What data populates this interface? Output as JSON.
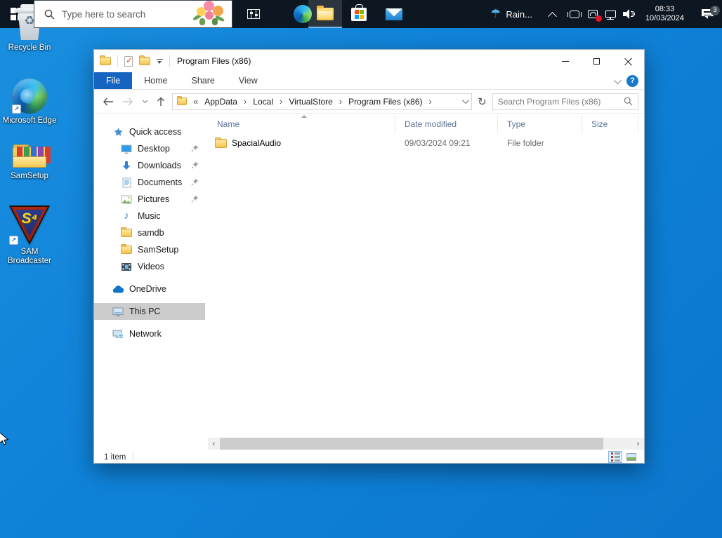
{
  "colors": {
    "accent_blue": "#0078d7",
    "file_tab_blue": "#1565c0",
    "desktop_blue": "#0f82d8",
    "taskbar_dark": "#0d1722",
    "selection_gray": "#cccccc",
    "folder_yellow": "#fbd968",
    "alert_red": "#e81224"
  },
  "glyphs": {
    "check": "✓",
    "refresh": "↻",
    "music_note": "♪",
    "recycle": "♻",
    "umbrella": "☂",
    "shortcut_arrow": "↗",
    "scroll_left": "‹",
    "scroll_right": "›",
    "help": "?"
  },
  "desktop": {
    "icons": [
      {
        "label": "Recycle Bin",
        "icon": "recycle-bin-icon"
      },
      {
        "label": "Microsoft Edge",
        "icon": "edge-icon",
        "shortcut": true
      },
      {
        "label": "SamSetup",
        "icon": "folder-with-files-icon"
      },
      {
        "label": "SAM Broadcaster",
        "icon": "sam-broadcaster-icon",
        "shortcut": true,
        "monogram": "S⁴"
      }
    ]
  },
  "explorer": {
    "title": "Program Files (x86)",
    "qat_icons": [
      "folder-icon",
      "properties-check-icon",
      "new-folder-icon",
      "customize-caret-icon"
    ],
    "tabs": [
      {
        "label": "File",
        "active": true
      },
      {
        "label": "Home",
        "active": false
      },
      {
        "label": "Share",
        "active": false
      },
      {
        "label": "View",
        "active": false
      }
    ],
    "breadcrumb": {
      "prefix": "«",
      "chevron": "›",
      "items": [
        "AppData",
        "Local",
        "VirtualStore",
        "Program Files (x86)"
      ]
    },
    "search_placeholder": "Search Program Files (x86)",
    "sidebar": [
      {
        "label": "Quick access",
        "icon": "star-icon",
        "indent": 0,
        "pinned": false,
        "selected": false
      },
      {
        "label": "Desktop",
        "icon": "desktop-monitor-icon",
        "indent": 1,
        "pinned": true,
        "selected": false
      },
      {
        "label": "Downloads",
        "icon": "download-arrow-icon",
        "indent": 1,
        "pinned": true,
        "selected": false
      },
      {
        "label": "Documents",
        "icon": "document-icon",
        "indent": 1,
        "pinned": true,
        "selected": false
      },
      {
        "label": "Pictures",
        "icon": "picture-icon",
        "indent": 1,
        "pinned": true,
        "selected": false
      },
      {
        "label": "Music",
        "icon": "music-note-icon",
        "indent": 1,
        "pinned": false,
        "selected": false
      },
      {
        "label": "samdb",
        "icon": "folder-icon",
        "indent": 1,
        "pinned": false,
        "selected": false
      },
      {
        "label": "SamSetup",
        "icon": "folder-icon",
        "indent": 1,
        "pinned": false,
        "selected": false
      },
      {
        "label": "Videos",
        "icon": "film-icon",
        "indent": 1,
        "pinned": false,
        "selected": false
      },
      {
        "label": "OneDrive",
        "icon": "onedrive-cloud-icon",
        "indent": 0,
        "pinned": false,
        "selected": false
      },
      {
        "label": "This PC",
        "icon": "computer-icon",
        "indent": 0,
        "pinned": false,
        "selected": true
      },
      {
        "label": "Network",
        "icon": "network-icon",
        "indent": 0,
        "pinned": false,
        "selected": false
      }
    ],
    "file_list": {
      "columns": [
        "Name",
        "Date modified",
        "Type",
        "Size"
      ],
      "sort": {
        "column": "Name",
        "direction": "ascending"
      },
      "rows": [
        {
          "name": "SpacialAudio",
          "icon": "folder-icon",
          "date_modified": "09/03/2024 09:21",
          "type": "File folder",
          "size": ""
        }
      ]
    },
    "status_bar": {
      "item_count": "1 item",
      "view_buttons": [
        "details-view-icon",
        "thumbnails-view-icon"
      ]
    }
  },
  "taskbar": {
    "search_placeholder": "Type here to search",
    "app_icons": [
      "task-view-icon",
      "edge-icon",
      "file-explorer-icon",
      "store-icon",
      "mail-icon"
    ],
    "active_app": "file-explorer-icon",
    "tray": {
      "weather": {
        "label": "Rain...",
        "icon": "umbrella-rain-icon"
      },
      "icons": [
        "chevron-up-icon",
        "meet-now-icon",
        "sync-alert-icon",
        "ethernet-icon",
        "volume-icon"
      ],
      "time": "08:33",
      "date": "10/03/2024",
      "notification_count": "3"
    }
  }
}
